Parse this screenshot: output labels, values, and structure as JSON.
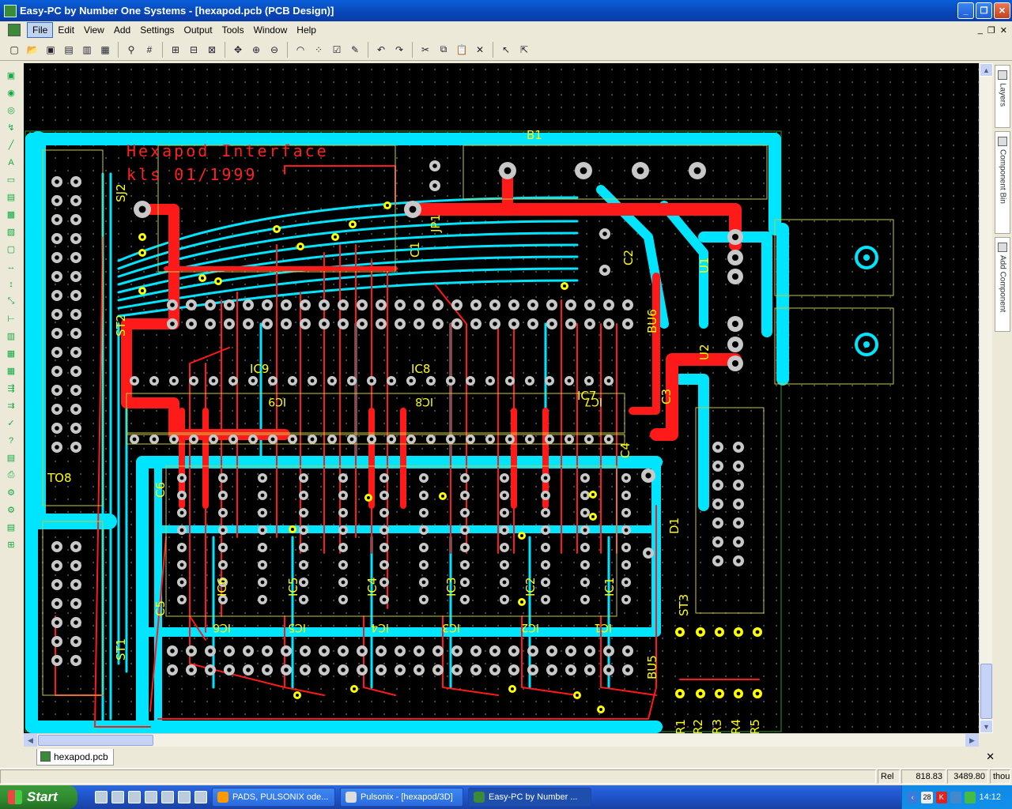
{
  "window": {
    "title": "Easy-PC by Number One Systems - [hexapod.pcb (PCB Design)]",
    "minimize": "_",
    "maximize": "❐",
    "close": "✕"
  },
  "menubar": {
    "items": [
      "File",
      "Edit",
      "View",
      "Add",
      "Settings",
      "Output",
      "Tools",
      "Window",
      "Help"
    ],
    "active": "File",
    "mdi_minimize": "_",
    "mdi_restore": "❐",
    "mdi_close": "✕"
  },
  "toolbar": {
    "icons": [
      "new-icon",
      "open-icon",
      "save-icon",
      "folder-icon",
      "book-icon",
      "frame-icon",
      "component-icon",
      "grid-icon",
      "align-icon",
      "align2-icon",
      "align3-icon",
      "move-icon",
      "zoom-in-icon",
      "zoom-out-icon",
      "rainbow-icon",
      "grid-dots-icon",
      "options-icon",
      "pen-icon",
      "undo-icon",
      "redo-icon",
      "cut-icon",
      "copy-icon",
      "paste-icon",
      "delete-icon",
      "select-icon",
      "select2-icon"
    ]
  },
  "right_panel": {
    "tabs": [
      "Layers",
      "Component Bin",
      "Add Component"
    ]
  },
  "board": {
    "title_text": "Hexapod Interface",
    "subtitle_text": "kls 01/1999",
    "component_labels": [
      "B1",
      "JP1",
      "C1",
      "C2",
      "U1",
      "U2",
      "BU6",
      "C3",
      "C4",
      "D1",
      "ST3",
      "BU5",
      "R1",
      "R2",
      "R3",
      "R4",
      "R5",
      "ST2",
      "ST1",
      "C5",
      "C6",
      "TO8",
      "IC1",
      "IC2",
      "IC3",
      "IC4",
      "IC5",
      "IC6",
      "IC7",
      "IC8",
      "IC9",
      "SJ2"
    ],
    "ic_labels": [
      "IC6",
      "IC5",
      "IC4",
      "IC3",
      "IC2",
      "IC1"
    ],
    "ic_upper_labels": [
      "IC9",
      "IC8",
      "IC7"
    ]
  },
  "doc_tab": {
    "label": "hexapod.pcb",
    "close": "✕"
  },
  "statusbar": {
    "mode": "Rel",
    "x": "818.83",
    "y": "3489.80",
    "units": "thou"
  },
  "taskbar": {
    "start": "Start",
    "tasks": [
      "PADS, PULSONIX ode...",
      "Pulsonix - [hexapod/3D]",
      "Easy-PC by Number ..."
    ],
    "active_task": 2,
    "tray_badge": "28",
    "clock": "14:12"
  },
  "colors": {
    "board_bg": "#000000",
    "copper_top": "#ff1a1a",
    "copper_bottom": "#00e5ff",
    "silkscreen": "#ffff00",
    "pad": "#c8c8c8"
  }
}
